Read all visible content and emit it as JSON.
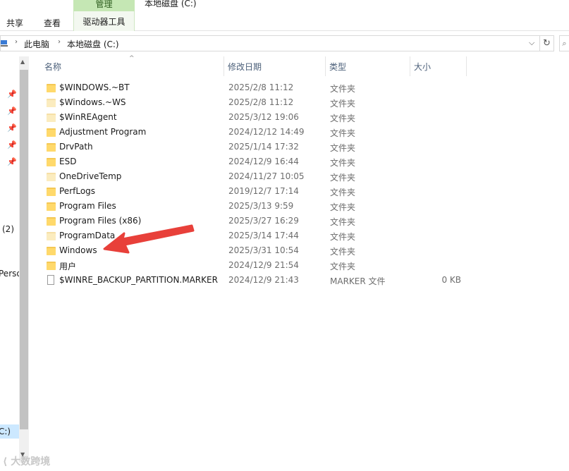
{
  "ribbon": {
    "tabs": [
      "共享",
      "查看"
    ],
    "context_group": "管理",
    "context_tab": "驱动器工具",
    "window_title": "本地磁盘 (C:)"
  },
  "address": {
    "crumbs": [
      "此电脑",
      "本地磁盘 (C:)"
    ],
    "refresh_icon": "refresh-icon",
    "dropdown_icon": "chevron-down-icon"
  },
  "nav": {
    "items": [
      "(2)",
      "Perso",
      "C:)"
    ],
    "pinned_count": 5
  },
  "columns": {
    "name": "名称",
    "date": "修改日期",
    "type": "类型",
    "size": "大小"
  },
  "files": [
    {
      "name": "$WINDOWS.~BT",
      "date": "2025/2/8 11:12",
      "type": "文件夹",
      "size": "",
      "icon": "folder",
      "hidden": false
    },
    {
      "name": "$Windows.~WS",
      "date": "2025/2/8 11:12",
      "type": "文件夹",
      "size": "",
      "icon": "folder",
      "hidden": true
    },
    {
      "name": "$WinREAgent",
      "date": "2025/3/12 19:06",
      "type": "文件夹",
      "size": "",
      "icon": "folder",
      "hidden": true
    },
    {
      "name": "Adjustment Program",
      "date": "2024/12/12 14:49",
      "type": "文件夹",
      "size": "",
      "icon": "folder",
      "hidden": false
    },
    {
      "name": "DrvPath",
      "date": "2025/1/14 17:32",
      "type": "文件夹",
      "size": "",
      "icon": "folder",
      "hidden": false
    },
    {
      "name": "ESD",
      "date": "2024/12/9 16:44",
      "type": "文件夹",
      "size": "",
      "icon": "folder",
      "hidden": false
    },
    {
      "name": "OneDriveTemp",
      "date": "2024/11/27 10:05",
      "type": "文件夹",
      "size": "",
      "icon": "folder",
      "hidden": true
    },
    {
      "name": "PerfLogs",
      "date": "2019/12/7 17:14",
      "type": "文件夹",
      "size": "",
      "icon": "folder",
      "hidden": false
    },
    {
      "name": "Program Files",
      "date": "2025/3/13 9:59",
      "type": "文件夹",
      "size": "",
      "icon": "folder",
      "hidden": false
    },
    {
      "name": "Program Files (x86)",
      "date": "2025/3/27 16:29",
      "type": "文件夹",
      "size": "",
      "icon": "folder",
      "hidden": false
    },
    {
      "name": "ProgramData",
      "date": "2025/3/14 17:44",
      "type": "文件夹",
      "size": "",
      "icon": "folder",
      "hidden": true
    },
    {
      "name": "Windows",
      "date": "2025/3/31 10:54",
      "type": "文件夹",
      "size": "",
      "icon": "folder",
      "hidden": false
    },
    {
      "name": "用户",
      "date": "2024/12/9 21:54",
      "type": "文件夹",
      "size": "",
      "icon": "folder",
      "hidden": false
    },
    {
      "name": "$WINRE_BACKUP_PARTITION.MARKER",
      "date": "2024/12/9 21:43",
      "type": "MARKER 文件",
      "size": "0 KB",
      "icon": "file",
      "hidden": false
    }
  ],
  "annotation": {
    "type": "red-arrow",
    "target": "Windows",
    "color": "#e8403a"
  },
  "watermark": "大数跨境",
  "colors": {
    "header_text": "#4c607a",
    "context_green": "#c5e7b4",
    "folder": "#ffd96b"
  }
}
